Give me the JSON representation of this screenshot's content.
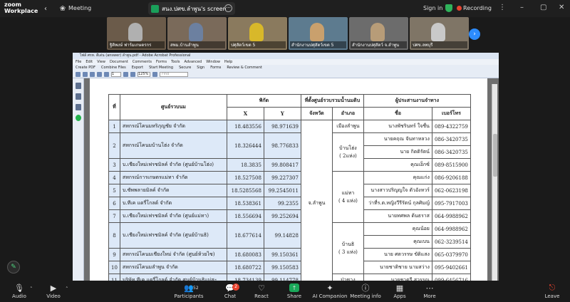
{
  "app": {
    "brand_line1": "zoom",
    "brand_line2": "Workplace",
    "meeting_label": "Meeting"
  },
  "share": {
    "label": "สนง.ปศข.ลำพูน's screen"
  },
  "topbar": {
    "signin_label": "Sign in",
    "recording_label": "Recording"
  },
  "thumbnails": [
    {
      "name": "ฐิติพงษ์ ฟาร์มเกษตรกร",
      "bg": "#6b5b4a",
      "shirt": "#b0b0b0"
    },
    {
      "name": "สพม.บ้านลำพูน",
      "bg": "#7a6a5a",
      "shirt": "#6c80a0"
    },
    {
      "name": "ปศุสัตว์เขต 5",
      "bg": "#8a7a5e",
      "shirt": "#d8b82a"
    },
    {
      "name": "สำนักงานปศุสัตว์เขต 5",
      "bg": "#5d7b8f",
      "shirt": "#c9a06d"
    },
    {
      "name": "สำนักงานปศุสัตว์ จ.ลำพูน",
      "bg": "#6c6c6c",
      "shirt": "#b79c78"
    },
    {
      "name": "ปศข.ลพบุรี",
      "bg": "#7f7566",
      "shirt": "#c9c9c9"
    }
  ],
  "acrobat": {
    "title": "ไฟล์ ศรท. ดีเด่น (answer) ลำพูน.pdf - Adobe Acrobat Professional",
    "menu": [
      "File",
      "Edit",
      "View",
      "Document",
      "Comments",
      "Forms",
      "Tools",
      "Advanced",
      "Window",
      "Help"
    ],
    "tools": [
      "Create PDF",
      "Combine Files",
      "Export",
      "Start Meeting",
      "Secure",
      "Sign",
      "Forms",
      "Review & Comment"
    ],
    "page_num": "1",
    "zoom": "125%",
    "search_placeholder": "Find"
  },
  "table": {
    "headers": {
      "no": "ที่",
      "center": "ศูนย์รวบนม",
      "coord": "พิกัด",
      "x": "X",
      "y": "Y",
      "location": "ที่ตั้งศูนย์รวบรวมน้ำนมดิบ",
      "province": "จังหวัด",
      "district": "อำเภอ",
      "coordinator": "ผู้ประสานงานจำทาง",
      "name": "ชื่อ",
      "phone": "เบอร์โทร"
    },
    "province_value": "จ.ลำพูน",
    "rows": [
      {
        "no": "1",
        "center": "สหกรณ์โคนมหริภุญชัย จำกัด",
        "x": "18.483556",
        "y": "98.971639",
        "district": "เมืองลำพูน",
        "persons": [
          {
            "name": "นางพัชรินทร์   ใจชื่น",
            "phone": "089-4322759"
          }
        ]
      },
      {
        "no": "2",
        "center": "สหกรณ์โคนมบ้านโฮ่ง จำกัด",
        "x": "18.326444",
        "y": "98.776833",
        "district": "บ้านโฮ่ง",
        "district2": "( 2แห่ง)",
        "persons": [
          {
            "name": "นายคฤณ  จันทาหลวง",
            "phone": "086-3420735"
          },
          {
            "name": "นาย กิตติรัตน์",
            "phone": "086-3420735"
          }
        ]
      },
      {
        "no": "3",
        "center": "บ.เชียงใหม่เฟรชมิลค์ จำกัด (ศูนย์บ้านโฮ่ง)",
        "x": "18.3835",
        "y": "99.808417",
        "district": "",
        "persons": [
          {
            "name": "คุณเอ็กซ์",
            "phone": "089-8515900"
          }
        ]
      },
      {
        "no": "4",
        "center": "สหกรณ์การเกษตรแม่ทา จำกัด",
        "x": "18.527508",
        "y": "99.227307",
        "district": "แม่ทา",
        "district2": "( 4 แห่ง)",
        "persons": [
          {
            "name": "คุณแก่ง",
            "phone": "086-9206188"
          }
        ]
      },
      {
        "no": "5",
        "center": "บ.ซัพพลายมิลค์ จำกัด",
        "x": "18.5285568",
        "y": "99.2545011",
        "district": "",
        "persons": [
          {
            "name": "นางสาวปริญญใจ ตัวอังหวร์",
            "phone": "062-0623198"
          }
        ]
      },
      {
        "no": "6",
        "center": "บ.ทีเค แดรี่โกลด์ จำกัด",
        "x": "18.538361",
        "y": "99.2355",
        "district": "",
        "persons": [
          {
            "name": "ว่าที่ร.ต.หญิงวีรีรัตน์  กุลศิมญ์",
            "phone": "095-7917003"
          }
        ]
      },
      {
        "no": "7",
        "center": "บ.เชียงใหม่เฟรชมิลค์ จำกัด (ศูนย์แม่ทา)",
        "x": "18.556694",
        "y": "99.252694",
        "district": "",
        "persons": [
          {
            "name": "นายทศพล  ต้นธราส",
            "phone": "064-9988962"
          }
        ]
      },
      {
        "no": "8",
        "center": "บ.เชียงใหม่เฟรชมิลค์ จำกัด (ศูนย์บ้านธิ)",
        "x": "18.677614",
        "y": "99.14828",
        "district": "บ้านธิ",
        "district2": "( 3 แห่ง)",
        "persons": [
          {
            "name": "คุณน้อย",
            "phone": "064-9988962"
          },
          {
            "name": "คุณเบน",
            "phone": "062-3239514"
          }
        ]
      },
      {
        "no": "9",
        "center": "สหกรณ์โคนมเชียงใหม่ จำกัด (ศูนย์ห้วยไซ)",
        "x": "18.680083",
        "y": "99.150361",
        "district": "",
        "persons": [
          {
            "name": "นาย ศตวรรษ  ขัติแสง",
            "phone": "065-0379970"
          }
        ]
      },
      {
        "no": "10",
        "center": "สหกรณ์โคนมลำพูน จำกัด",
        "x": "18.680722",
        "y": "99.150583",
        "district": "",
        "persons": [
          {
            "name": "นายชาติชาย  นามสว่าง",
            "phone": "095-9402661"
          }
        ]
      },
      {
        "no": "11",
        "center": "บริษัท ทีเค แดรี่โกลด์ จำกัด  ศูนย์บ้านธิแม่สะ",
        "x": "18.734139",
        "y": "99.114778",
        "district": "ป่าซาง",
        "persons": [
          {
            "name": "นายชาตรี สุวรรณ",
            "phone": "099-6456716"
          }
        ]
      }
    ]
  },
  "bottombar": {
    "audio": "Audio",
    "video": "Video",
    "participants": "Participants",
    "participants_count": "52",
    "chat": "Chat",
    "chat_badge": "2",
    "react": "React",
    "share": "Share",
    "ai": "AI Companion",
    "info": "Meeting info",
    "apps": "Apps",
    "more": "More",
    "leave": "Leave"
  },
  "colors": {
    "accent": "#2d8cff",
    "record": "#e8432f",
    "share_green": "#1a9f5a",
    "row_shade": "#dde9f8"
  }
}
